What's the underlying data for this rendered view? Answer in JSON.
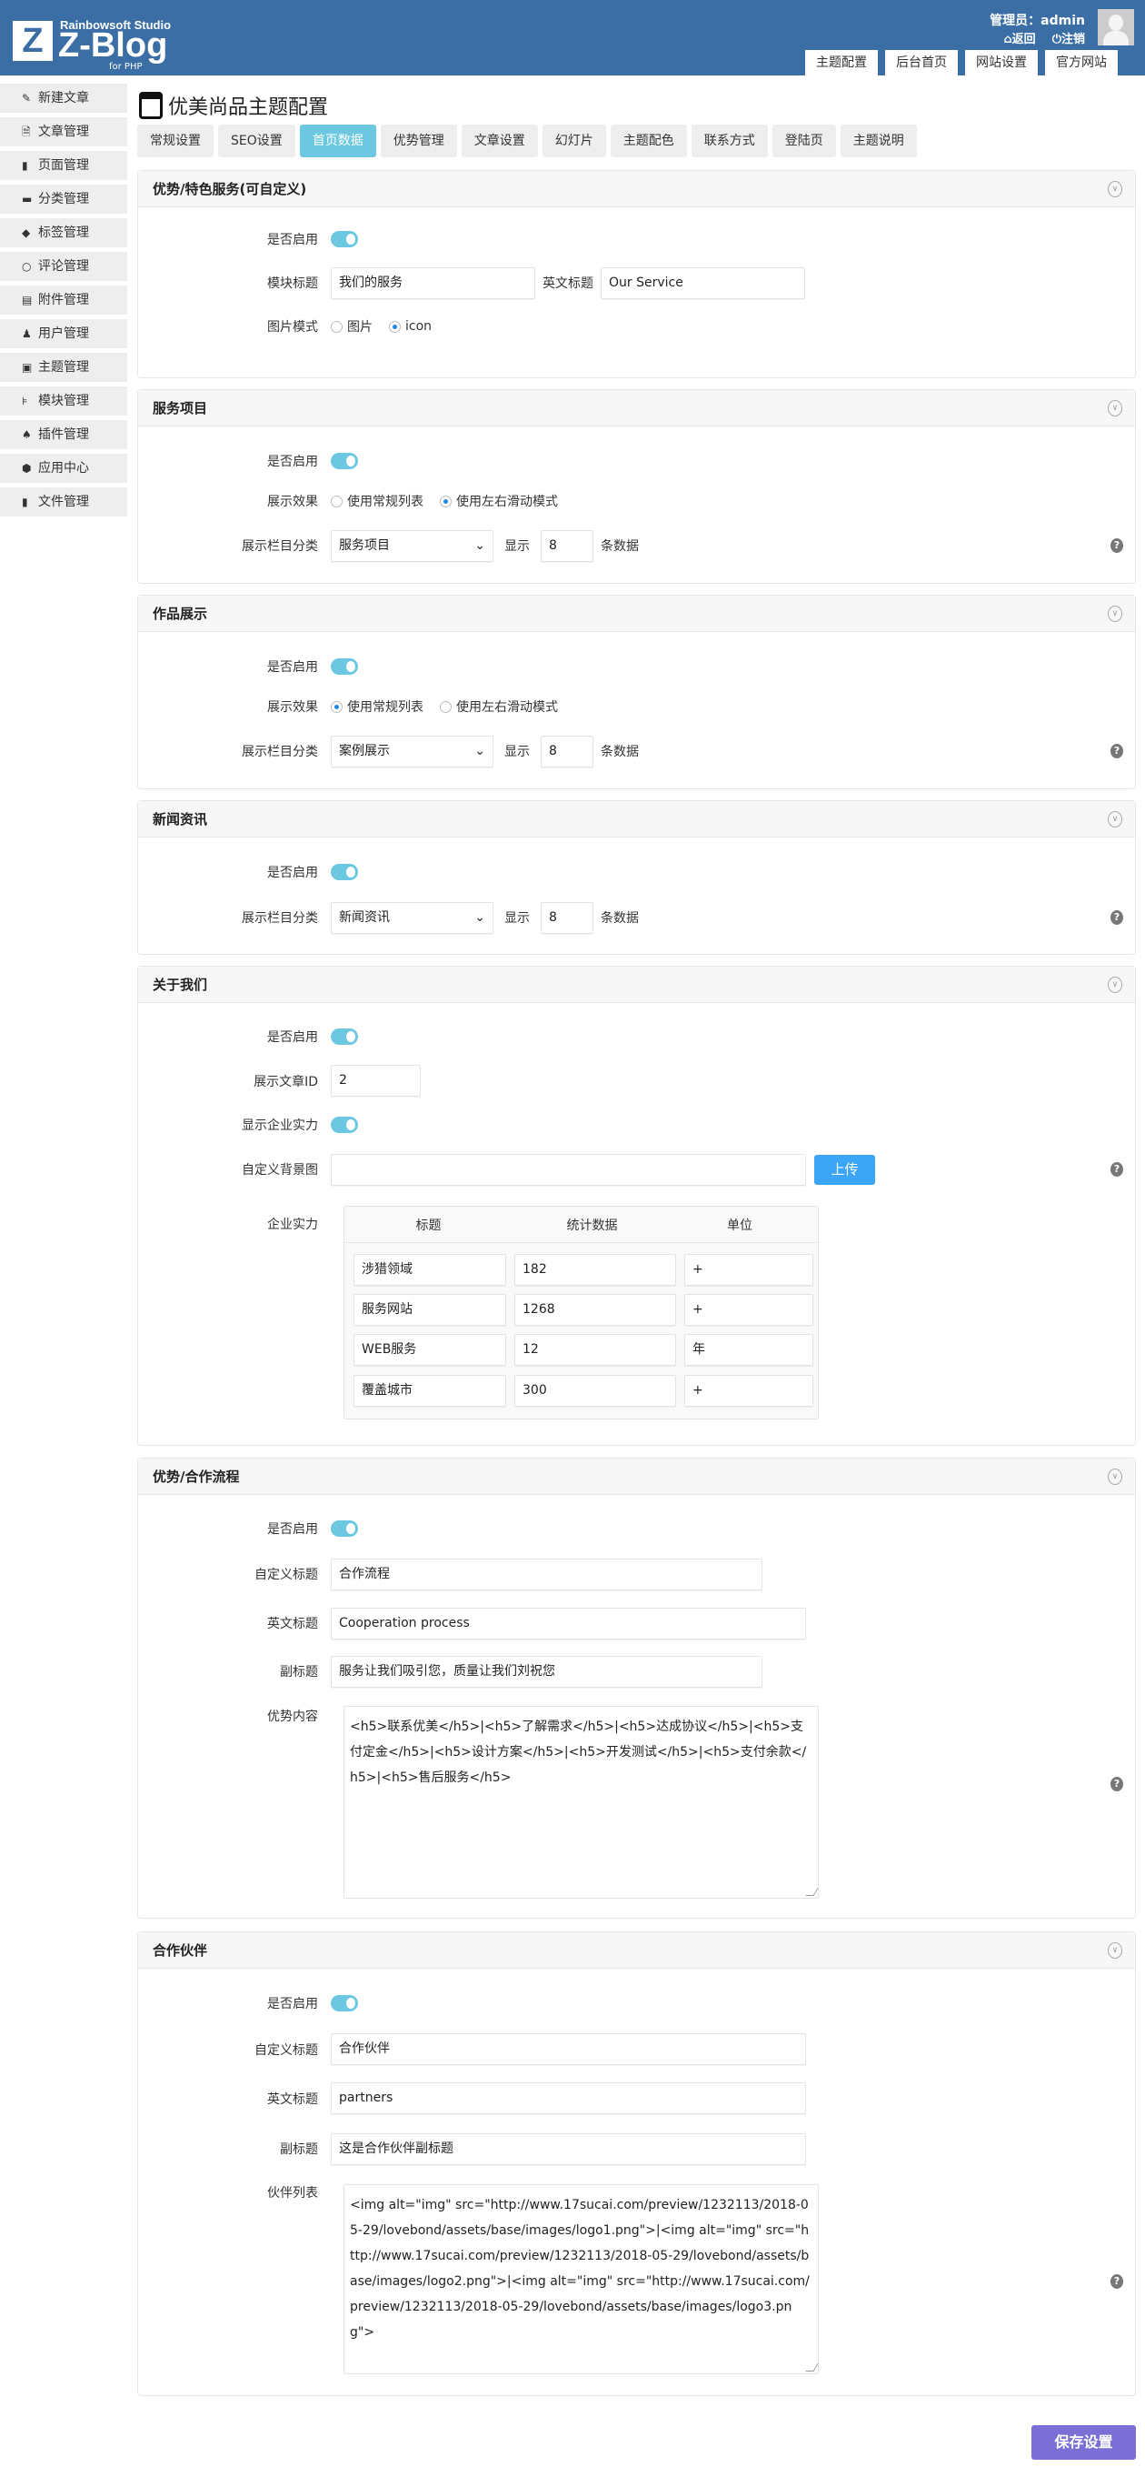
{
  "header": {
    "logo_letter": "Z",
    "studio": "Rainbowsoft Studio",
    "product": "Z-Blog",
    "edition": "for PHP",
    "admin": "管理员：admin",
    "back": "返回",
    "logout": "注销",
    "nav": [
      "主题配置",
      "后台首页",
      "网站设置",
      "官方网站"
    ]
  },
  "sidebar": {
    "items": [
      {
        "label": "新建文章",
        "icon": "edit-icon"
      },
      {
        "label": "文章管理",
        "icon": "article-icon"
      },
      {
        "label": "页面管理",
        "icon": "page-icon"
      },
      {
        "label": "分类管理",
        "icon": "folder-icon"
      },
      {
        "label": "标签管理",
        "icon": "tag-icon"
      },
      {
        "label": "评论管理",
        "icon": "comment-icon"
      },
      {
        "label": "附件管理",
        "icon": "attachment-icon"
      },
      {
        "label": "用户管理",
        "icon": "user-icon"
      },
      {
        "label": "主题管理",
        "icon": "theme-icon"
      },
      {
        "label": "模块管理",
        "icon": "module-icon"
      },
      {
        "label": "插件管理",
        "icon": "plugin-icon"
      },
      {
        "label": "应用中心",
        "icon": "app-icon"
      },
      {
        "label": "文件管理",
        "icon": "file-icon"
      }
    ]
  },
  "page": {
    "title": "优美尚品主题配置",
    "tabs": [
      "常规设置",
      "SEO设置",
      "首页数据",
      "优势管理",
      "文章设置",
      "幻灯片",
      "主题配色",
      "联系方式",
      "登陆页",
      "主题说明"
    ],
    "active_tab": "首页数据"
  },
  "colors": {
    "header": "#3b6ea5",
    "accent": "#6bc8e0",
    "upload": "#3ca5f6",
    "save": "#7b6fd6"
  },
  "labels": {
    "enable": "是否启用",
    "module_title": "模块标题",
    "en_title": "英文标题",
    "image_mode": "图片模式",
    "display_effect": "展示效果",
    "category": "展示栏目分类",
    "show": "显示",
    "items_unit": "条数据",
    "list_mode": "使用常规列表",
    "slide_mode": "使用左右滑动模式",
    "article_id": "展示文章ID",
    "show_strength": "显示企业实力",
    "bg_image": "自定义背景图",
    "strength": "企业实力",
    "custom_title": "自定义标题",
    "subtitle": "副标题",
    "adv_content": "优势内容",
    "partner_list": "伙伴列表",
    "upload": "上传",
    "help": "?"
  },
  "s1": {
    "title": "优势/特色服务(可自定义)",
    "enabled": true,
    "module_title": "我们的服务",
    "en_title": "Our Service",
    "opt_image": "图片",
    "opt_icon": "icon",
    "mode": "icon"
  },
  "s2": {
    "title": "服务项目",
    "enabled": true,
    "effect": "使用左右滑动模式",
    "category": "服务项目",
    "count": "8"
  },
  "s3": {
    "title": "作品展示",
    "enabled": true,
    "effect": "使用常规列表",
    "category": "案例展示",
    "count": "8"
  },
  "s4": {
    "title": "新闻资讯",
    "enabled": true,
    "category": "新闻资讯",
    "count": "8"
  },
  "s5": {
    "title": "关于我们",
    "enabled": true,
    "article_id": "2",
    "show_strength": true,
    "bg_image": "",
    "columns": [
      "标题",
      "统计数据",
      "单位"
    ],
    "rows": [
      [
        "涉猎领域",
        "182",
        "+"
      ],
      [
        "服务网站",
        "1268",
        "+"
      ],
      [
        "WEB服务",
        "12",
        "年"
      ],
      [
        "覆盖城市",
        "300",
        "+"
      ]
    ]
  },
  "s6": {
    "title": "优势/合作流程",
    "enabled": true,
    "custom_title": "合作流程",
    "en_title": "Cooperation process",
    "subtitle": "服务让我们吸引您，质量让我们刘祝您",
    "content": "<h5>联系优美</h5>|<h5>了解需求</h5>|<h5>达成协议</h5>|<h5>支付定金</h5>|<h5>设计方案</h5>|<h5>开发测试</h5>|<h5>支付余款</h5>|<h5>售后服务</h5>"
  },
  "s7": {
    "title": "合作伙伴",
    "enabled": true,
    "custom_title": "合作伙伴",
    "en_title": "partners",
    "subtitle": "这是合作伙伴副标题",
    "content": "<img alt=\"img\" src=\"http://www.17sucai.com/preview/1232113/2018-05-29/lovebond/assets/base/images/logo1.png\">|<img alt=\"img\" src=\"http://www.17sucai.com/preview/1232113/2018-05-29/lovebond/assets/base/images/logo2.png\">|<img alt=\"img\" src=\"http://www.17sucai.com/preview/1232113/2018-05-29/lovebond/assets/base/images/logo3.png\">"
  },
  "save": "保存设置"
}
